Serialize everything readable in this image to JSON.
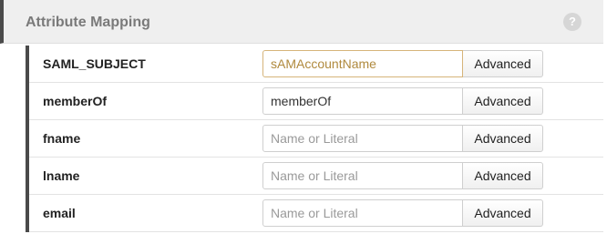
{
  "header": {
    "title": "Attribute Mapping",
    "help_icon": "?"
  },
  "rows": [
    {
      "label": "SAML_SUBJECT",
      "value": "sAMAccountName",
      "placeholder": "",
      "button": "Advanced"
    },
    {
      "label": "memberOf",
      "value": "memberOf",
      "placeholder": "",
      "button": "Advanced"
    },
    {
      "label": "fname",
      "value": "",
      "placeholder": "Name or Literal",
      "button": "Advanced"
    },
    {
      "label": "lname",
      "value": "",
      "placeholder": "Name or Literal",
      "button": "Advanced"
    },
    {
      "label": "email",
      "value": "",
      "placeholder": "Name or Literal",
      "button": "Advanced"
    }
  ],
  "colors": {
    "focused_border": "#d6b47a",
    "focused_text": "#b08a3e",
    "accent_bar": "#4a4a4a"
  }
}
